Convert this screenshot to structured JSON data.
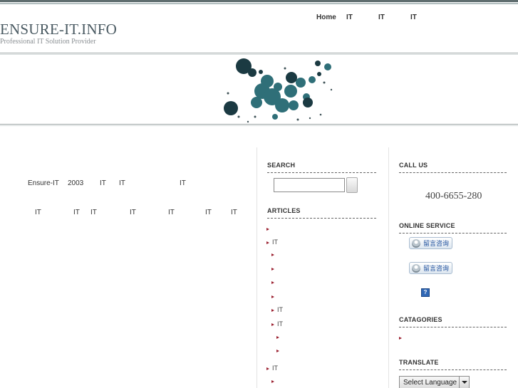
{
  "site": {
    "title": "ENSURE-IT.INFO",
    "tagline": "Professional IT Solution Provider"
  },
  "nav": {
    "items": [
      "Home",
      "IT",
      "IT",
      "IT"
    ]
  },
  "intro": {
    "line1": [
      "Ensure-IT",
      "2003",
      "IT",
      "IT",
      "IT"
    ],
    "line2": [
      "IT",
      "IT",
      "IT",
      "IT",
      "IT",
      "IT",
      "IT"
    ]
  },
  "search": {
    "heading": "SEARCH",
    "value": "",
    "button_label": ""
  },
  "articles": {
    "heading": "ARTICLES",
    "items": [
      "",
      "IT",
      "",
      "",
      "",
      "",
      "IT",
      "IT",
      "",
      "",
      "IT",
      ""
    ]
  },
  "call": {
    "heading": "CALL US",
    "phone": "400-6655-280"
  },
  "online": {
    "heading": "ONLINE SERVICE",
    "buttons": [
      "留言咨询",
      "留言咨询"
    ],
    "help_glyph": "?"
  },
  "categories": {
    "heading": "CATAGORIES",
    "items": [
      ""
    ]
  },
  "translate": {
    "heading": "TRANSLATE",
    "select_value": "Select Language"
  },
  "colors": {
    "bullet": "#9a1e2e",
    "banner_teal": "#2f6f78",
    "banner_dark": "#1b3a42",
    "brand_text": "#4a5a62"
  }
}
